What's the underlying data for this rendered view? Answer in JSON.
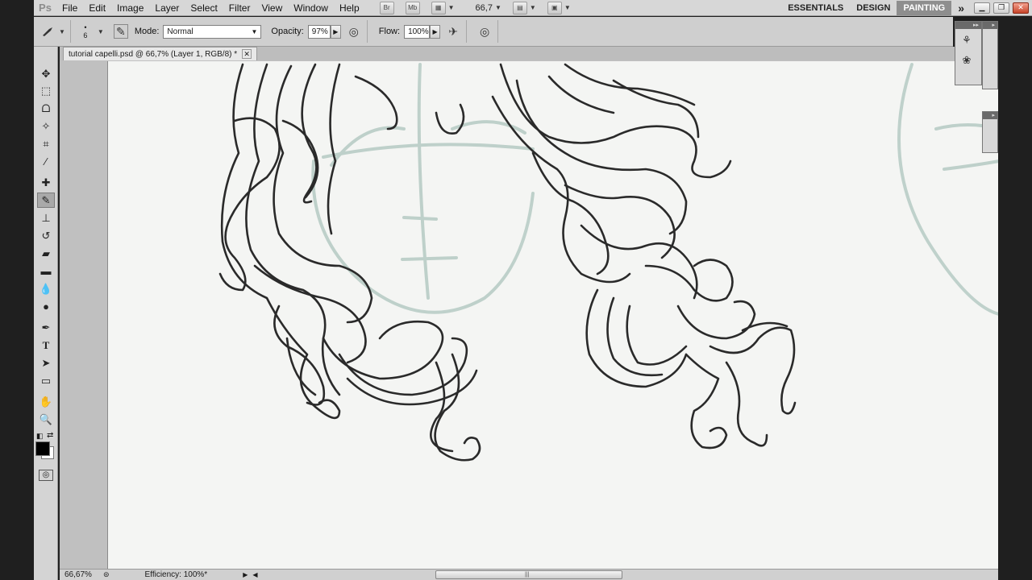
{
  "menubar": {
    "logo": "Ps",
    "items": [
      "File",
      "Edit",
      "Image",
      "Layer",
      "Select",
      "Filter",
      "View",
      "Window",
      "Help"
    ],
    "bridge_label": "Br",
    "minibridge_label": "Mb",
    "zoom": "66,7",
    "workspaces": [
      "ESSENTIALS",
      "DESIGN",
      "PAINTING"
    ],
    "active_workspace": "PAINTING",
    "more": "»"
  },
  "options": {
    "brush_size": "6",
    "mode_label": "Mode:",
    "mode_value": "Normal",
    "opacity_label": "Opacity:",
    "opacity_value": "97%",
    "flow_label": "Flow:",
    "flow_value": "100%"
  },
  "document": {
    "tab_title": "tutorial capelli.psd @ 66,7% (Layer 1, RGB/8) *",
    "close": "✕"
  },
  "status": {
    "zoom": "66,67%",
    "info": "Efficiency: 100%*"
  },
  "colors": {
    "foreground": "#000000",
    "background": "#ffffff",
    "sketch_line": "#2a2a2a",
    "guide_line": "#b9cdc6"
  },
  "icons": {
    "tools": [
      "move",
      "marquee",
      "lasso",
      "quick-select",
      "crop",
      "eyedropper",
      "spot-heal",
      "brush",
      "clone-stamp",
      "history-brush",
      "eraser",
      "gradient",
      "blur",
      "dodge",
      "pen",
      "type",
      "path-select",
      "shape",
      "hand",
      "zoom"
    ]
  }
}
